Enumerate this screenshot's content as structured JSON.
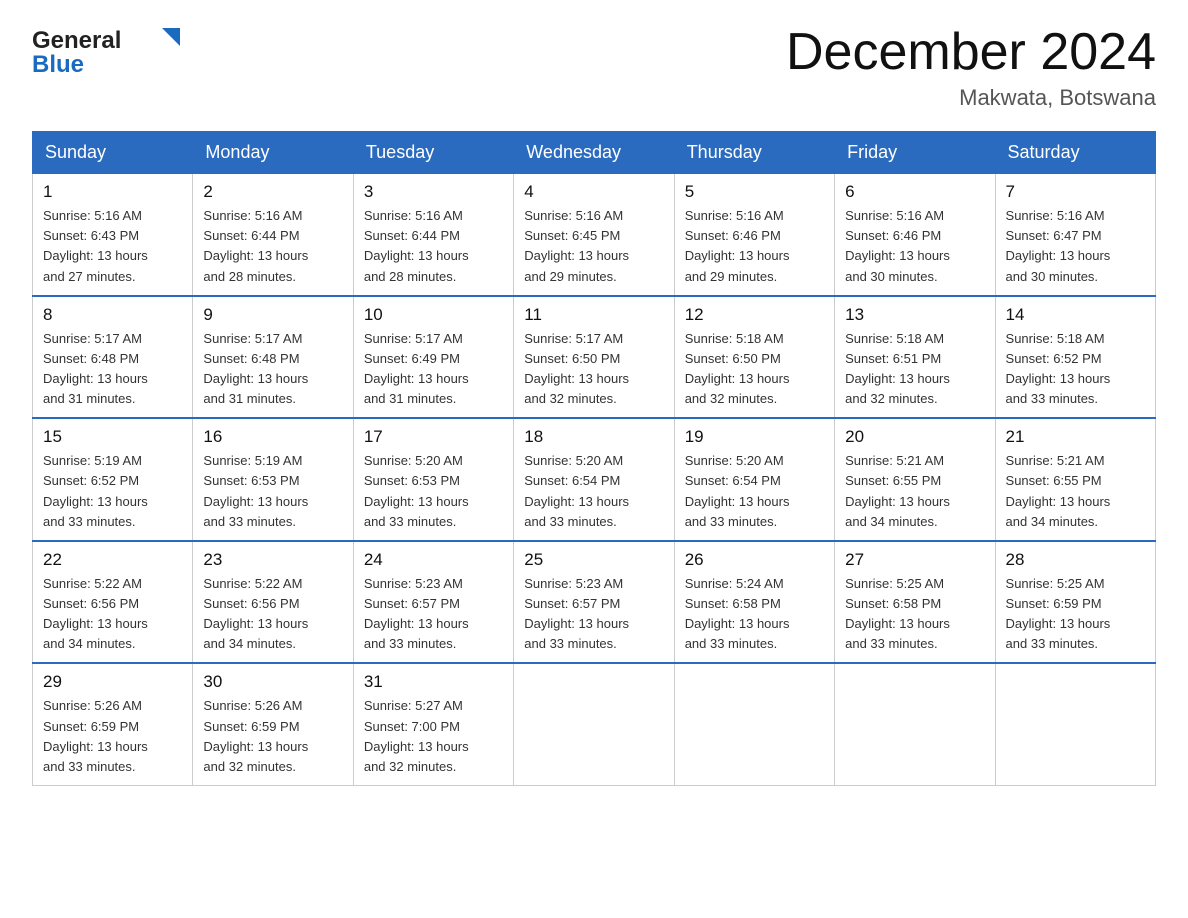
{
  "logo": {
    "text_general": "General",
    "text_blue": "Blue"
  },
  "header": {
    "month_title": "December 2024",
    "location": "Makwata, Botswana"
  },
  "days_of_week": [
    "Sunday",
    "Monday",
    "Tuesday",
    "Wednesday",
    "Thursday",
    "Friday",
    "Saturday"
  ],
  "weeks": [
    [
      {
        "day": "1",
        "sunrise": "5:16 AM",
        "sunset": "6:43 PM",
        "daylight": "13 hours and 27 minutes."
      },
      {
        "day": "2",
        "sunrise": "5:16 AM",
        "sunset": "6:44 PM",
        "daylight": "13 hours and 28 minutes."
      },
      {
        "day": "3",
        "sunrise": "5:16 AM",
        "sunset": "6:44 PM",
        "daylight": "13 hours and 28 minutes."
      },
      {
        "day": "4",
        "sunrise": "5:16 AM",
        "sunset": "6:45 PM",
        "daylight": "13 hours and 29 minutes."
      },
      {
        "day": "5",
        "sunrise": "5:16 AM",
        "sunset": "6:46 PM",
        "daylight": "13 hours and 29 minutes."
      },
      {
        "day": "6",
        "sunrise": "5:16 AM",
        "sunset": "6:46 PM",
        "daylight": "13 hours and 30 minutes."
      },
      {
        "day": "7",
        "sunrise": "5:16 AM",
        "sunset": "6:47 PM",
        "daylight": "13 hours and 30 minutes."
      }
    ],
    [
      {
        "day": "8",
        "sunrise": "5:17 AM",
        "sunset": "6:48 PM",
        "daylight": "13 hours and 31 minutes."
      },
      {
        "day": "9",
        "sunrise": "5:17 AM",
        "sunset": "6:48 PM",
        "daylight": "13 hours and 31 minutes."
      },
      {
        "day": "10",
        "sunrise": "5:17 AM",
        "sunset": "6:49 PM",
        "daylight": "13 hours and 31 minutes."
      },
      {
        "day": "11",
        "sunrise": "5:17 AM",
        "sunset": "6:50 PM",
        "daylight": "13 hours and 32 minutes."
      },
      {
        "day": "12",
        "sunrise": "5:18 AM",
        "sunset": "6:50 PM",
        "daylight": "13 hours and 32 minutes."
      },
      {
        "day": "13",
        "sunrise": "5:18 AM",
        "sunset": "6:51 PM",
        "daylight": "13 hours and 32 minutes."
      },
      {
        "day": "14",
        "sunrise": "5:18 AM",
        "sunset": "6:52 PM",
        "daylight": "13 hours and 33 minutes."
      }
    ],
    [
      {
        "day": "15",
        "sunrise": "5:19 AM",
        "sunset": "6:52 PM",
        "daylight": "13 hours and 33 minutes."
      },
      {
        "day": "16",
        "sunrise": "5:19 AM",
        "sunset": "6:53 PM",
        "daylight": "13 hours and 33 minutes."
      },
      {
        "day": "17",
        "sunrise": "5:20 AM",
        "sunset": "6:53 PM",
        "daylight": "13 hours and 33 minutes."
      },
      {
        "day": "18",
        "sunrise": "5:20 AM",
        "sunset": "6:54 PM",
        "daylight": "13 hours and 33 minutes."
      },
      {
        "day": "19",
        "sunrise": "5:20 AM",
        "sunset": "6:54 PM",
        "daylight": "13 hours and 33 minutes."
      },
      {
        "day": "20",
        "sunrise": "5:21 AM",
        "sunset": "6:55 PM",
        "daylight": "13 hours and 34 minutes."
      },
      {
        "day": "21",
        "sunrise": "5:21 AM",
        "sunset": "6:55 PM",
        "daylight": "13 hours and 34 minutes."
      }
    ],
    [
      {
        "day": "22",
        "sunrise": "5:22 AM",
        "sunset": "6:56 PM",
        "daylight": "13 hours and 34 minutes."
      },
      {
        "day": "23",
        "sunrise": "5:22 AM",
        "sunset": "6:56 PM",
        "daylight": "13 hours and 34 minutes."
      },
      {
        "day": "24",
        "sunrise": "5:23 AM",
        "sunset": "6:57 PM",
        "daylight": "13 hours and 33 minutes."
      },
      {
        "day": "25",
        "sunrise": "5:23 AM",
        "sunset": "6:57 PM",
        "daylight": "13 hours and 33 minutes."
      },
      {
        "day": "26",
        "sunrise": "5:24 AM",
        "sunset": "6:58 PM",
        "daylight": "13 hours and 33 minutes."
      },
      {
        "day": "27",
        "sunrise": "5:25 AM",
        "sunset": "6:58 PM",
        "daylight": "13 hours and 33 minutes."
      },
      {
        "day": "28",
        "sunrise": "5:25 AM",
        "sunset": "6:59 PM",
        "daylight": "13 hours and 33 minutes."
      }
    ],
    [
      {
        "day": "29",
        "sunrise": "5:26 AM",
        "sunset": "6:59 PM",
        "daylight": "13 hours and 33 minutes."
      },
      {
        "day": "30",
        "sunrise": "5:26 AM",
        "sunset": "6:59 PM",
        "daylight": "13 hours and 32 minutes."
      },
      {
        "day": "31",
        "sunrise": "5:27 AM",
        "sunset": "7:00 PM",
        "daylight": "13 hours and 32 minutes."
      },
      null,
      null,
      null,
      null
    ]
  ]
}
